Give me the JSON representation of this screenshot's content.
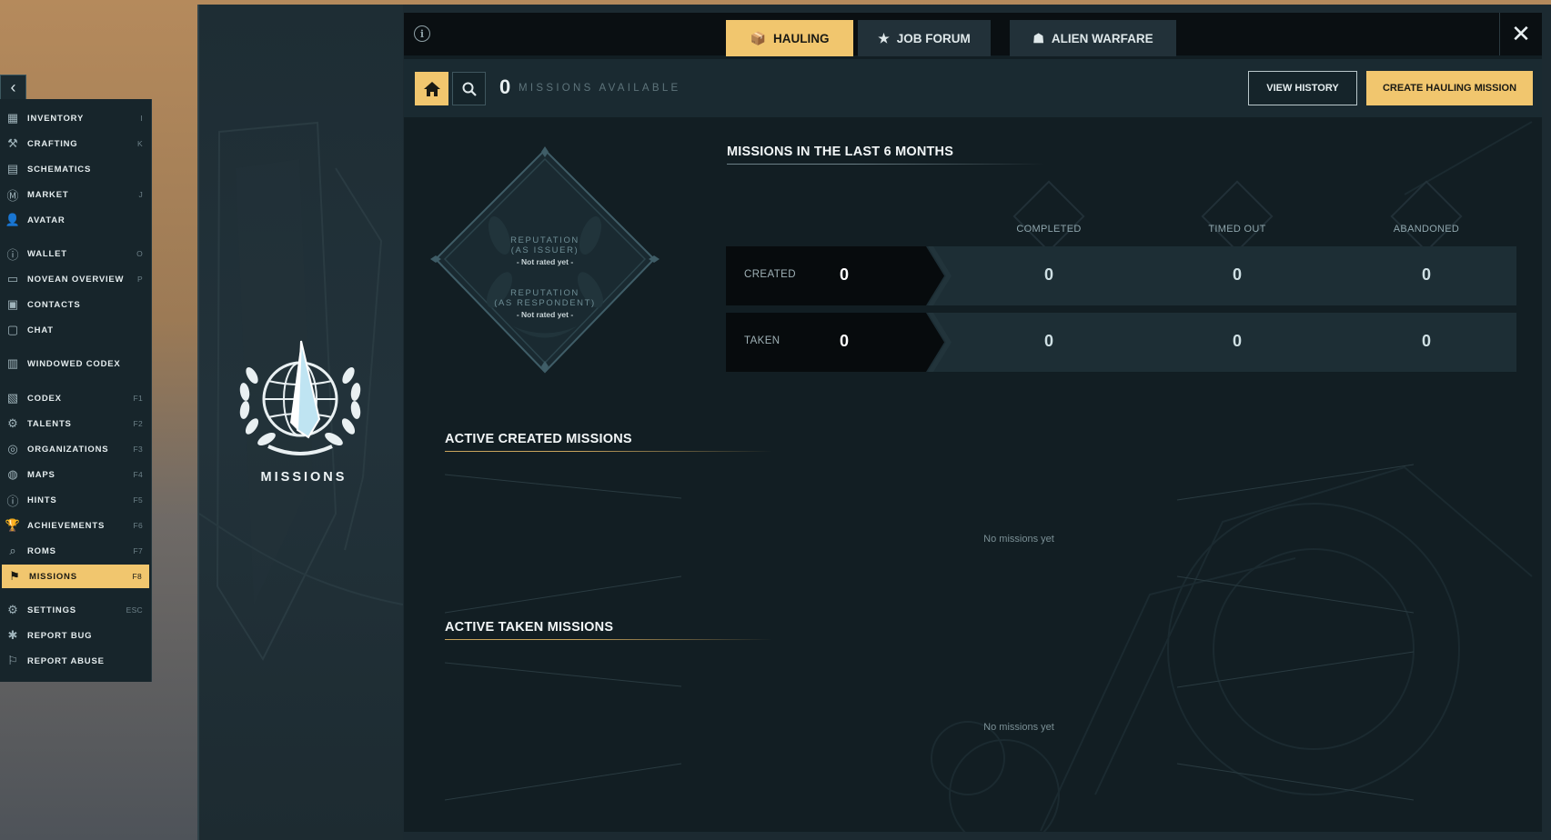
{
  "sidebar": {
    "collapse_icon": "chevron-left-icon",
    "items": [
      {
        "id": "inventory",
        "label": "INVENTORY",
        "key": "I",
        "icon": "inventory-icon",
        "glyph": "▦"
      },
      {
        "id": "crafting",
        "label": "CRAFTING",
        "key": "K",
        "icon": "crafting-icon",
        "glyph": "⚒"
      },
      {
        "id": "schematics",
        "label": "SCHEMATICS",
        "key": "",
        "icon": "schematics-icon",
        "glyph": "▤"
      },
      {
        "id": "market",
        "label": "MARKET",
        "key": "J",
        "icon": "market-icon",
        "glyph": "Ⓜ"
      },
      {
        "id": "avatar",
        "label": "AVATAR",
        "key": "",
        "icon": "avatar-icon",
        "glyph": "👤"
      },
      {
        "id": "wallet",
        "label": "WALLET",
        "key": "O",
        "icon": "wallet-icon",
        "glyph": "ⓘ"
      },
      {
        "id": "novean-overview",
        "label": "NOVEAN OVERVIEW",
        "key": "P",
        "icon": "id-card-icon",
        "glyph": "▭"
      },
      {
        "id": "contacts",
        "label": "CONTACTS",
        "key": "",
        "icon": "contacts-icon",
        "glyph": "▣"
      },
      {
        "id": "chat",
        "label": "CHAT",
        "key": "",
        "icon": "chat-icon",
        "glyph": "▢"
      },
      {
        "id": "windowed-codex",
        "label": "WINDOWED CODEX",
        "key": "",
        "icon": "windowed-codex-icon",
        "glyph": "▥"
      },
      {
        "id": "codex",
        "label": "CODEX",
        "key": "F1",
        "icon": "codex-icon",
        "glyph": "▧"
      },
      {
        "id": "talents",
        "label": "TALENTS",
        "key": "F2",
        "icon": "talents-icon",
        "glyph": "⚙"
      },
      {
        "id": "organizations",
        "label": "ORGANIZATIONS",
        "key": "F3",
        "icon": "organizations-icon",
        "glyph": "◎"
      },
      {
        "id": "maps",
        "label": "MAPS",
        "key": "F4",
        "icon": "maps-icon",
        "glyph": "◍"
      },
      {
        "id": "hints",
        "label": "HINTS",
        "key": "F5",
        "icon": "hints-icon",
        "glyph": "ⓘ"
      },
      {
        "id": "achievements",
        "label": "ACHIEVEMENTS",
        "key": "F6",
        "icon": "trophy-icon",
        "glyph": "🏆"
      },
      {
        "id": "roms",
        "label": "ROMS",
        "key": "F7",
        "icon": "roms-icon",
        "glyph": "⌕"
      },
      {
        "id": "missions",
        "label": "MISSIONS",
        "key": "F8",
        "icon": "missions-icon",
        "glyph": "⚑",
        "active": true
      },
      {
        "id": "settings",
        "label": "SETTINGS",
        "key": "ESC",
        "icon": "gear-icon",
        "glyph": "⚙"
      },
      {
        "id": "report-bug",
        "label": "REPORT BUG",
        "key": "",
        "icon": "bug-icon",
        "glyph": "✱"
      },
      {
        "id": "report-abuse",
        "label": "REPORT ABUSE",
        "key": "",
        "icon": "flag-icon",
        "glyph": "⚐"
      }
    ]
  },
  "brand": {
    "title": "MISSIONS",
    "logo_icon": "missions-laurel-globe-icon"
  },
  "topbar": {
    "info_icon": "info-icon",
    "tabs": [
      {
        "label": "HAULING",
        "icon": "package-icon",
        "glyph": "📦",
        "active": true
      },
      {
        "label": "JOB FORUM",
        "icon": "star-icon",
        "glyph": "★",
        "active": false
      },
      {
        "label": "ALIEN WARFARE",
        "icon": "alien-icon",
        "glyph": "☗",
        "active": false
      }
    ],
    "close_icon": "close-icon"
  },
  "toolbar": {
    "home_icon": "home-icon",
    "search_icon": "search-icon",
    "missions_count": "0",
    "missions_label": "MISSIONS AVAILABLE",
    "view_history_label": "VIEW HISTORY",
    "create_label": "CREATE HAULING MISSION"
  },
  "reputation": {
    "issuer_label_1": "REPUTATION",
    "issuer_label_2": "(AS ISSUER)",
    "issuer_value": "- Not rated yet -",
    "respondent_label_1": "REPUTATION",
    "respondent_label_2": "(AS RESPONDENT)",
    "respondent_value": "- Not rated yet -"
  },
  "stats": {
    "title": "MISSIONS IN THE LAST 6 MONTHS",
    "columns": [
      {
        "label": "COMPLETED",
        "icon": "checkmark-icon"
      },
      {
        "label": "TIMED OUT",
        "icon": "stopwatch-icon"
      },
      {
        "label": "ABANDONED",
        "icon": "abandoned-icon"
      }
    ],
    "rows": [
      {
        "label": "CREATED",
        "total": "0",
        "values": [
          "0",
          "0",
          "0"
        ]
      },
      {
        "label": "TAKEN",
        "total": "0",
        "values": [
          "0",
          "0",
          "0"
        ]
      }
    ]
  },
  "active_created": {
    "title": "ACTIVE CREATED MISSIONS",
    "empty": "No missions yet"
  },
  "active_taken": {
    "title": "ACTIVE TAKEN MISSIONS",
    "empty": "No missions yet"
  },
  "colors": {
    "accent": "#f1c66e",
    "panel": "#121e23",
    "dark": "#070b0d",
    "gold_line": "#c9a45c"
  }
}
